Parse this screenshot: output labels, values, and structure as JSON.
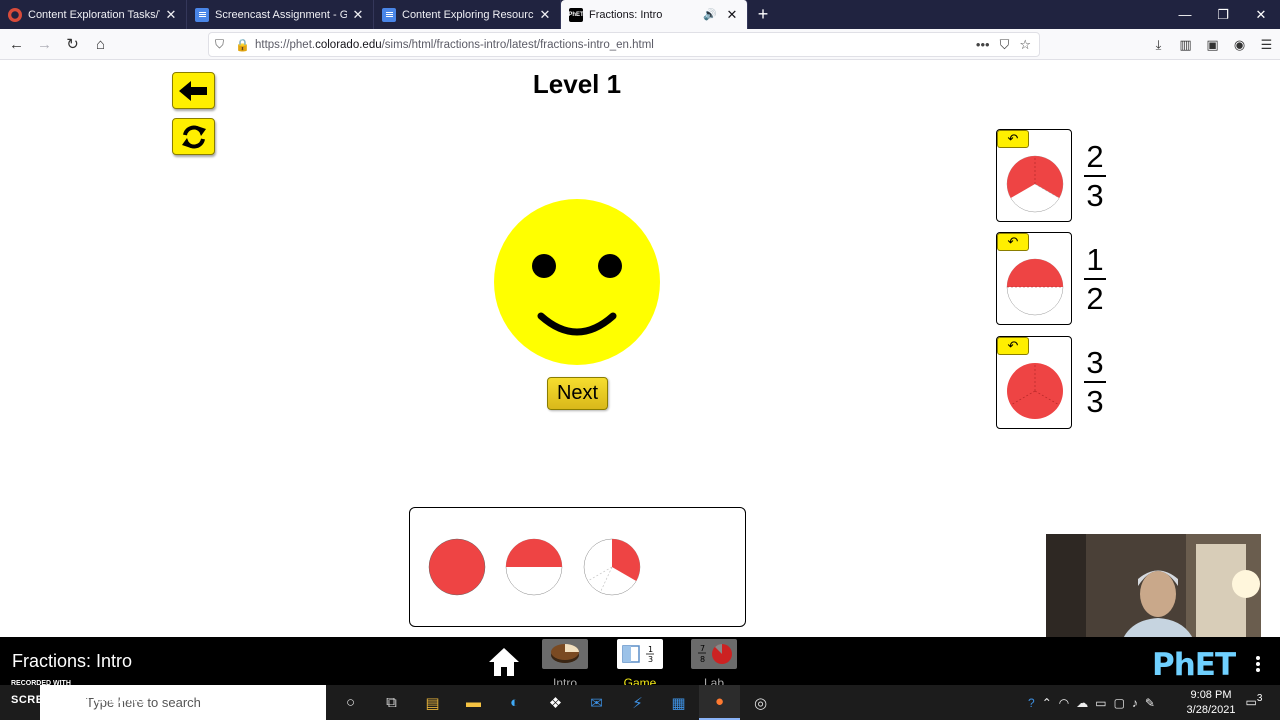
{
  "browser": {
    "tabs": [
      {
        "title": "Content Exploration Tasks/Too",
        "icon": "red-circle-icon",
        "active": false
      },
      {
        "title": "Screencast Assignment - Goog",
        "icon": "google-docs-icon",
        "active": false
      },
      {
        "title": "Content Exploring Resources -",
        "icon": "google-docs-icon",
        "active": false
      },
      {
        "title": "Fractions: Intro",
        "icon": "phet-icon",
        "active": true
      }
    ],
    "url_prefix": "https://phet.",
    "url_domain": "colorado.edu",
    "url_path": "/sims/html/fractions-intro/latest/fractions-intro_en.html"
  },
  "sim": {
    "level_title": "Level 1",
    "next_label": "Next",
    "face_color": "#ffff00",
    "piece_color": "#ee4444",
    "targets": [
      {
        "numerator": "2",
        "denominator": "3"
      },
      {
        "numerator": "1",
        "denominator": "2"
      },
      {
        "numerator": "3",
        "denominator": "3"
      }
    ]
  },
  "phet_nav": {
    "title": "Fractions: Intro",
    "screens": [
      {
        "label": "Intro",
        "selected": false
      },
      {
        "label": "Game",
        "selected": true
      },
      {
        "label": "Lab",
        "selected": false
      }
    ],
    "logo": "PhET",
    "recorded_with": "RECORDED WITH"
  },
  "taskbar": {
    "search_placeholder": "Type here to search",
    "watermark": "SCREENCAST-O-MATIC",
    "time": "9:08 PM",
    "date": "3/28/2021",
    "notification_count": "3"
  }
}
